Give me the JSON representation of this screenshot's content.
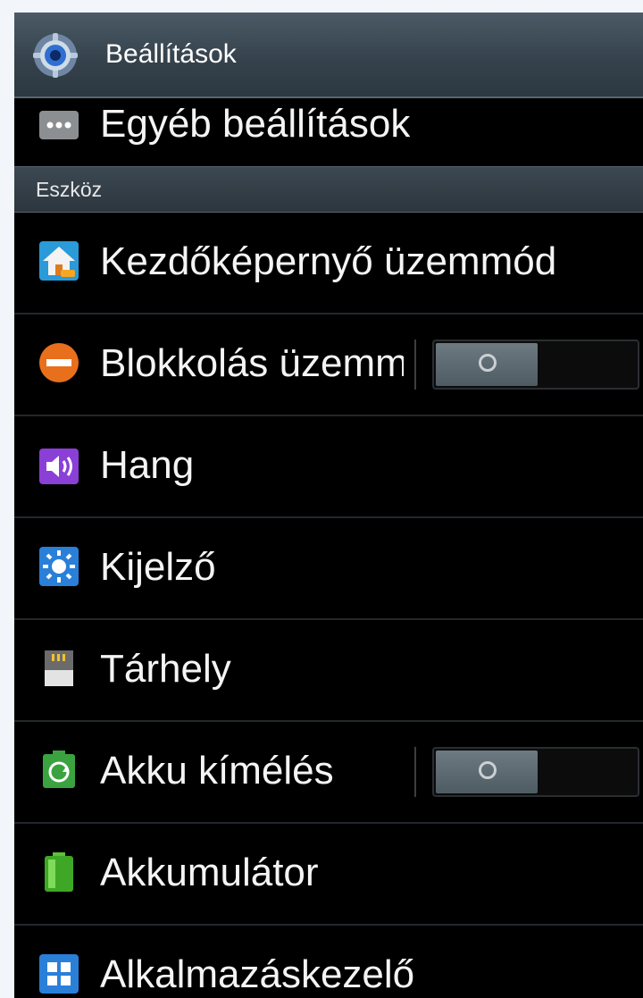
{
  "header": {
    "title": "Beállítások",
    "icon": "settings-gear-icon"
  },
  "rows_top": [
    {
      "label": "Egyéb beállítások",
      "icon": "more-dots-icon"
    }
  ],
  "section": {
    "label": "Eszköz"
  },
  "rows": [
    {
      "label": "Kezdőképernyő üzemmód",
      "icon": "home-screen-icon"
    },
    {
      "label": "Blokkolás üzemmód",
      "icon": "block-icon",
      "toggle": "off"
    },
    {
      "label": "Hang",
      "icon": "sound-icon"
    },
    {
      "label": "Kijelző",
      "icon": "display-icon"
    },
    {
      "label": "Tárhely",
      "icon": "storage-icon"
    },
    {
      "label": "Akku kímélés",
      "icon": "battery-saver-icon",
      "toggle": "off"
    },
    {
      "label": "Akkumulátor",
      "icon": "battery-icon"
    },
    {
      "label": "Alkalmazáskezelő",
      "icon": "app-manager-icon"
    }
  ],
  "colors": {
    "background": "#000000",
    "header": "#3a4650",
    "text": "#f4f4f4"
  }
}
